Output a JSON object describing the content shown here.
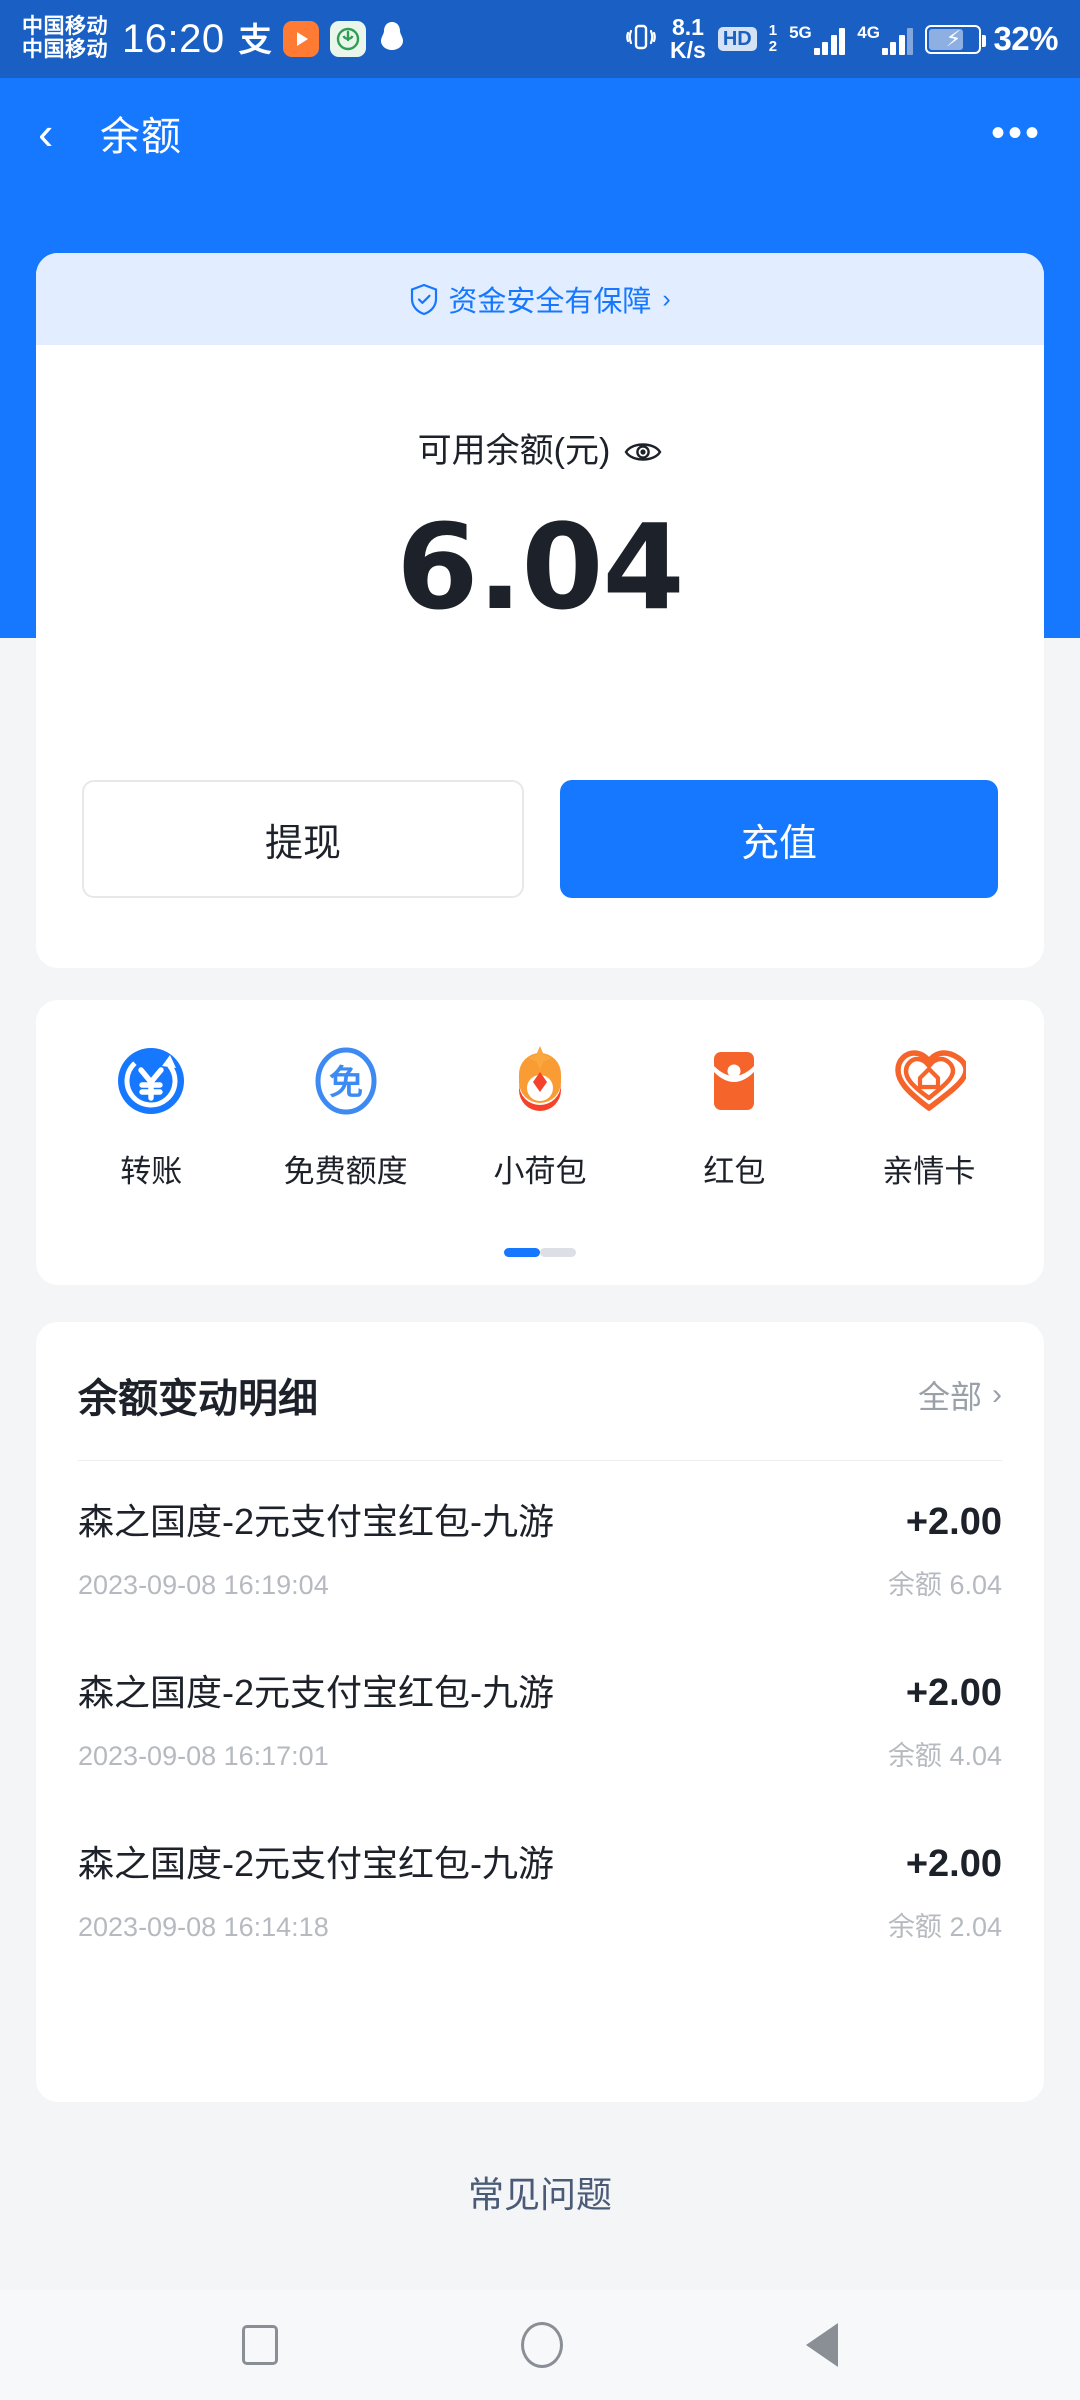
{
  "statusbar": {
    "carrier_line1": "中国移动",
    "carrier_line2": "中国移动",
    "time": "16:20",
    "alipay_glyph": "支",
    "netspeed_value": "8.1",
    "netspeed_unit": "K/s",
    "hd_badge": "HD",
    "sim_1": "1",
    "sim_2": "2",
    "net_5g": "5G",
    "net_4g": "4G",
    "battery_percent": "32%"
  },
  "header": {
    "title": "余额",
    "back_icon": "‹",
    "more_icon": "•••"
  },
  "balance_card": {
    "safety_text": "资金安全有保障",
    "safety_chevron": "›",
    "available_label": "可用余额(元)",
    "amount": "6.04",
    "withdraw_label": "提现",
    "topup_label": "充值"
  },
  "shortcuts": {
    "items": [
      {
        "label": "转账",
        "icon": "transfer-icon"
      },
      {
        "label": "免费额度",
        "icon": "free-quota-icon"
      },
      {
        "label": "小荷包",
        "icon": "pocket-icon"
      },
      {
        "label": "红包",
        "icon": "red-packet-icon"
      },
      {
        "label": "亲情卡",
        "icon": "family-card-icon"
      }
    ]
  },
  "transactions": {
    "title": "余额变动明细",
    "all_label": "全部",
    "all_chevron": "›",
    "rows": [
      {
        "name": "森之国度-2元支付宝红包-九游",
        "amount": "+2.00",
        "date": "2023-09-08 16:19:04",
        "balance": "余额 6.04"
      },
      {
        "name": "森之国度-2元支付宝红包-九游",
        "amount": "+2.00",
        "date": "2023-09-08 16:17:01",
        "balance": "余额 4.04"
      },
      {
        "name": "森之国度-2元支付宝红包-九游",
        "amount": "+2.00",
        "date": "2023-09-08 16:14:18",
        "balance": "余额 2.04"
      }
    ]
  },
  "faq": {
    "label": "常见问题"
  },
  "colors": {
    "brand_blue": "#1677ff",
    "status_blue": "#1a5fc4",
    "safe_strip": "#e2eeff",
    "orange": "#f5642a",
    "page_bg": "#f4f5f7"
  }
}
